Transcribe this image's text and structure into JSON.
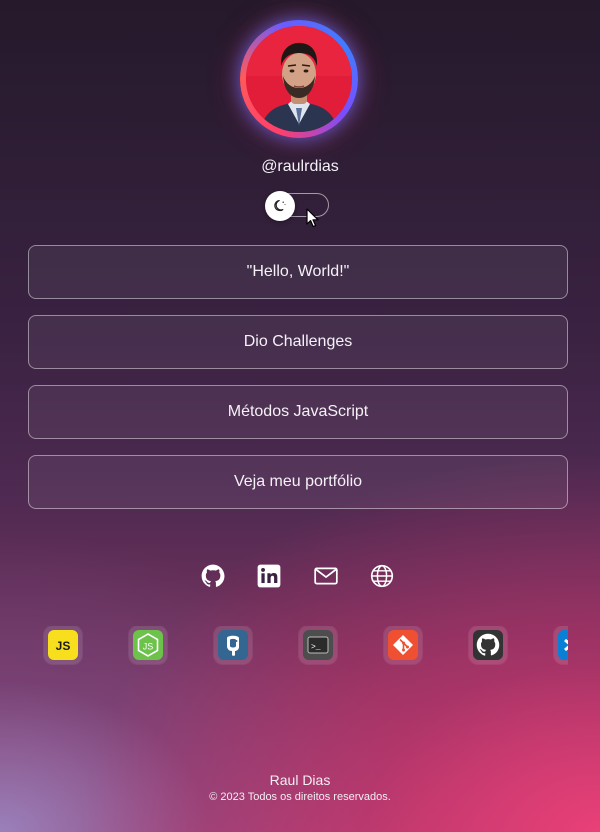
{
  "profile": {
    "handle": "@raulrdias",
    "theme_toggle": {
      "state": "dark",
      "icon": "moon-icon"
    }
  },
  "links": [
    {
      "label": "\"Hello, World!\""
    },
    {
      "label": "Dio Challenges"
    },
    {
      "label": "Métodos JavaScript"
    },
    {
      "label": "Veja meu portfólio"
    }
  ],
  "social": [
    {
      "icon": "github-icon"
    },
    {
      "icon": "linkedin-icon"
    },
    {
      "icon": "mail-icon"
    },
    {
      "icon": "globe-icon"
    }
  ],
  "tech": [
    {
      "icon": "javascript-icon",
      "label": "JS",
      "color": "#f7df1e"
    },
    {
      "icon": "nodejs-icon",
      "label": "JS",
      "color": "#6cc24a"
    },
    {
      "icon": "postgresql-icon",
      "color": "#336791"
    },
    {
      "icon": "terminal-icon",
      "label": ">_",
      "color": "#4d4d4d"
    },
    {
      "icon": "git-icon",
      "color": "#f05032"
    },
    {
      "icon": "github-icon",
      "color": "#333333"
    },
    {
      "icon": "vscode-icon",
      "color": "#0a7fd6"
    }
  ],
  "footer": {
    "name": "Raul Dias",
    "copyright": "© 2023 Todos os direitos reservados."
  },
  "colors": {
    "accent_pink": "#ec4078",
    "ring_blue": "#3f7dff",
    "ring_red": "#ff3f6c"
  }
}
